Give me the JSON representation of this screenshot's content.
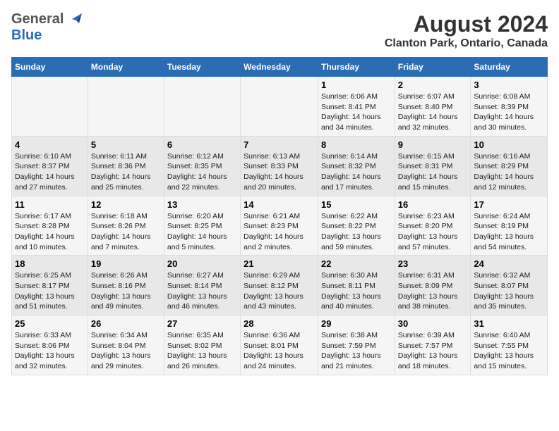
{
  "header": {
    "logo_general": "General",
    "logo_blue": "Blue",
    "month_year": "August 2024",
    "location": "Clanton Park, Ontario, Canada"
  },
  "weekdays": [
    "Sunday",
    "Monday",
    "Tuesday",
    "Wednesday",
    "Thursday",
    "Friday",
    "Saturday"
  ],
  "weeks": [
    [
      {
        "day": "",
        "detail": ""
      },
      {
        "day": "",
        "detail": ""
      },
      {
        "day": "",
        "detail": ""
      },
      {
        "day": "",
        "detail": ""
      },
      {
        "day": "1",
        "detail": "Sunrise: 6:06 AM\nSunset: 8:41 PM\nDaylight: 14 hours\nand 34 minutes."
      },
      {
        "day": "2",
        "detail": "Sunrise: 6:07 AM\nSunset: 8:40 PM\nDaylight: 14 hours\nand 32 minutes."
      },
      {
        "day": "3",
        "detail": "Sunrise: 6:08 AM\nSunset: 8:39 PM\nDaylight: 14 hours\nand 30 minutes."
      }
    ],
    [
      {
        "day": "4",
        "detail": "Sunrise: 6:10 AM\nSunset: 8:37 PM\nDaylight: 14 hours\nand 27 minutes."
      },
      {
        "day": "5",
        "detail": "Sunrise: 6:11 AM\nSunset: 8:36 PM\nDaylight: 14 hours\nand 25 minutes."
      },
      {
        "day": "6",
        "detail": "Sunrise: 6:12 AM\nSunset: 8:35 PM\nDaylight: 14 hours\nand 22 minutes."
      },
      {
        "day": "7",
        "detail": "Sunrise: 6:13 AM\nSunset: 8:33 PM\nDaylight: 14 hours\nand 20 minutes."
      },
      {
        "day": "8",
        "detail": "Sunrise: 6:14 AM\nSunset: 8:32 PM\nDaylight: 14 hours\nand 17 minutes."
      },
      {
        "day": "9",
        "detail": "Sunrise: 6:15 AM\nSunset: 8:31 PM\nDaylight: 14 hours\nand 15 minutes."
      },
      {
        "day": "10",
        "detail": "Sunrise: 6:16 AM\nSunset: 8:29 PM\nDaylight: 14 hours\nand 12 minutes."
      }
    ],
    [
      {
        "day": "11",
        "detail": "Sunrise: 6:17 AM\nSunset: 8:28 PM\nDaylight: 14 hours\nand 10 minutes."
      },
      {
        "day": "12",
        "detail": "Sunrise: 6:18 AM\nSunset: 8:26 PM\nDaylight: 14 hours\nand 7 minutes."
      },
      {
        "day": "13",
        "detail": "Sunrise: 6:20 AM\nSunset: 8:25 PM\nDaylight: 14 hours\nand 5 minutes."
      },
      {
        "day": "14",
        "detail": "Sunrise: 6:21 AM\nSunset: 8:23 PM\nDaylight: 14 hours\nand 2 minutes."
      },
      {
        "day": "15",
        "detail": "Sunrise: 6:22 AM\nSunset: 8:22 PM\nDaylight: 13 hours\nand 59 minutes."
      },
      {
        "day": "16",
        "detail": "Sunrise: 6:23 AM\nSunset: 8:20 PM\nDaylight: 13 hours\nand 57 minutes."
      },
      {
        "day": "17",
        "detail": "Sunrise: 6:24 AM\nSunset: 8:19 PM\nDaylight: 13 hours\nand 54 minutes."
      }
    ],
    [
      {
        "day": "18",
        "detail": "Sunrise: 6:25 AM\nSunset: 8:17 PM\nDaylight: 13 hours\nand 51 minutes."
      },
      {
        "day": "19",
        "detail": "Sunrise: 6:26 AM\nSunset: 8:16 PM\nDaylight: 13 hours\nand 49 minutes."
      },
      {
        "day": "20",
        "detail": "Sunrise: 6:27 AM\nSunset: 8:14 PM\nDaylight: 13 hours\nand 46 minutes."
      },
      {
        "day": "21",
        "detail": "Sunrise: 6:29 AM\nSunset: 8:12 PM\nDaylight: 13 hours\nand 43 minutes."
      },
      {
        "day": "22",
        "detail": "Sunrise: 6:30 AM\nSunset: 8:11 PM\nDaylight: 13 hours\nand 40 minutes."
      },
      {
        "day": "23",
        "detail": "Sunrise: 6:31 AM\nSunset: 8:09 PM\nDaylight: 13 hours\nand 38 minutes."
      },
      {
        "day": "24",
        "detail": "Sunrise: 6:32 AM\nSunset: 8:07 PM\nDaylight: 13 hours\nand 35 minutes."
      }
    ],
    [
      {
        "day": "25",
        "detail": "Sunrise: 6:33 AM\nSunset: 8:06 PM\nDaylight: 13 hours\nand 32 minutes."
      },
      {
        "day": "26",
        "detail": "Sunrise: 6:34 AM\nSunset: 8:04 PM\nDaylight: 13 hours\nand 29 minutes."
      },
      {
        "day": "27",
        "detail": "Sunrise: 6:35 AM\nSunset: 8:02 PM\nDaylight: 13 hours\nand 26 minutes."
      },
      {
        "day": "28",
        "detail": "Sunrise: 6:36 AM\nSunset: 8:01 PM\nDaylight: 13 hours\nand 24 minutes."
      },
      {
        "day": "29",
        "detail": "Sunrise: 6:38 AM\nSunset: 7:59 PM\nDaylight: 13 hours\nand 21 minutes."
      },
      {
        "day": "30",
        "detail": "Sunrise: 6:39 AM\nSunset: 7:57 PM\nDaylight: 13 hours\nand 18 minutes."
      },
      {
        "day": "31",
        "detail": "Sunrise: 6:40 AM\nSunset: 7:55 PM\nDaylight: 13 hours\nand 15 minutes."
      }
    ]
  ]
}
